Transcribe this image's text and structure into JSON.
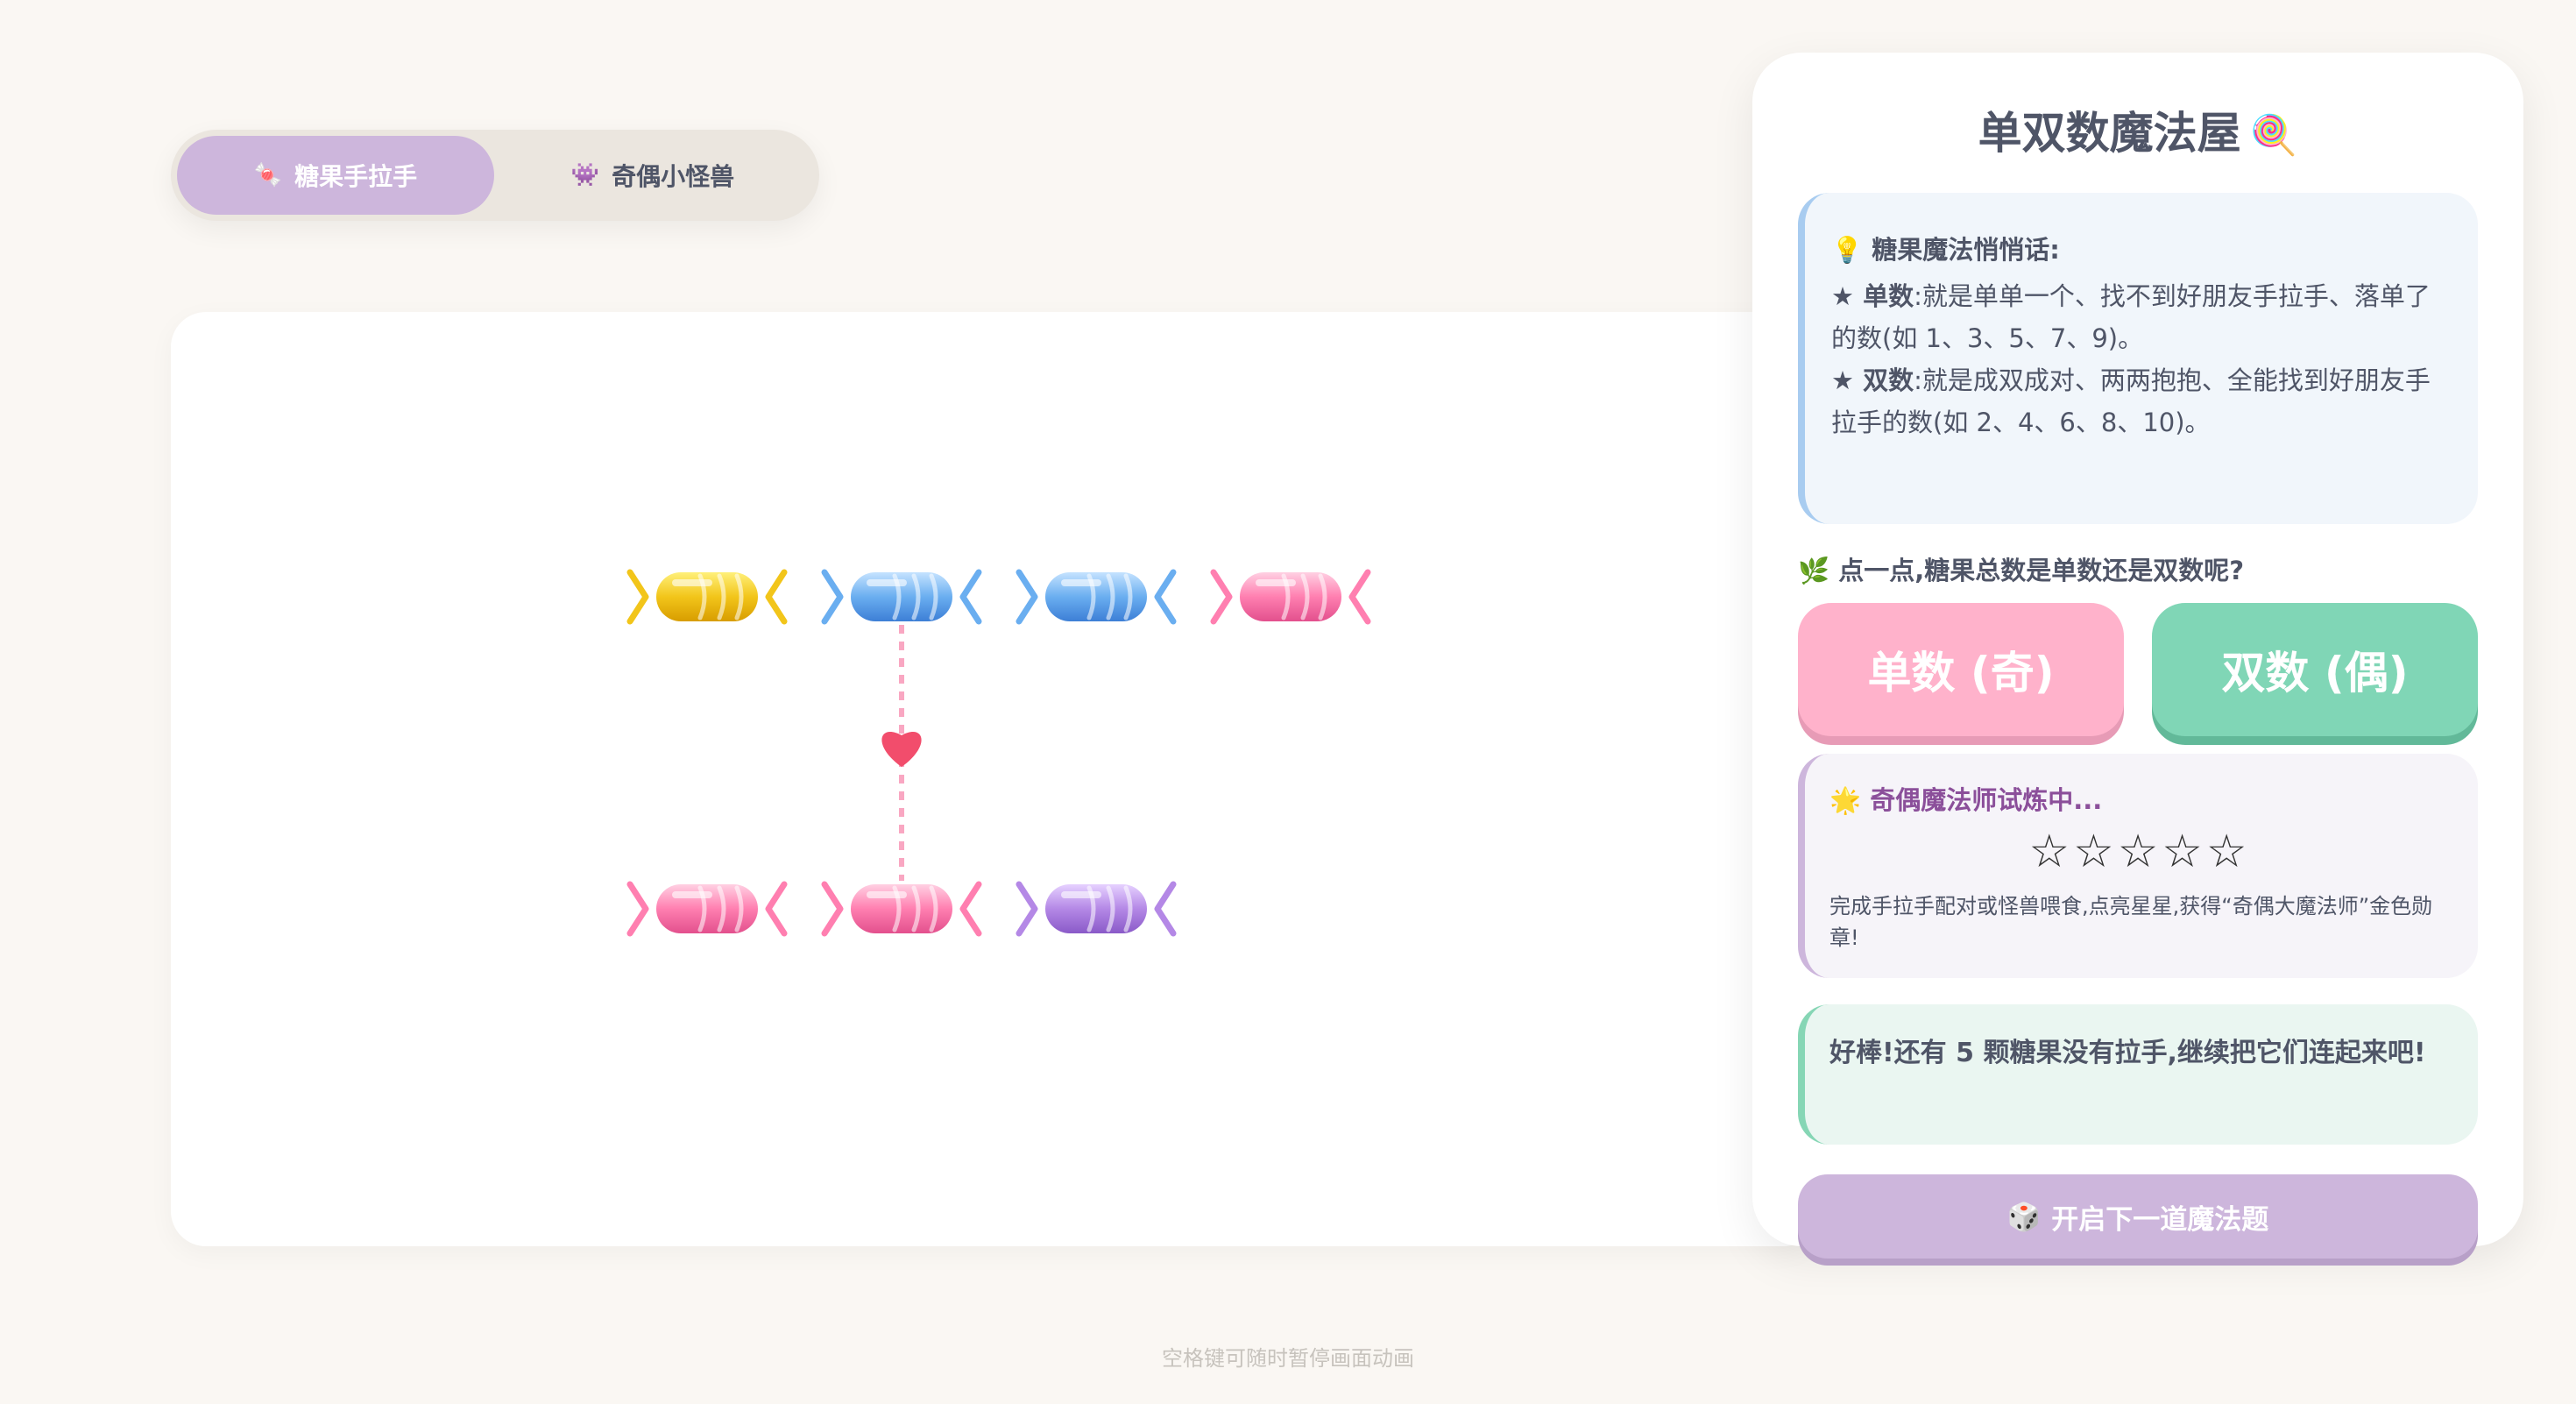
{
  "tabs": [
    {
      "icon": "🍬",
      "icon_name": "candy-icon",
      "label": "糖果手拉手",
      "active": true
    },
    {
      "icon": "👾",
      "icon_name": "monster-icon",
      "label": "奇偶小怪兽",
      "active": false
    }
  ],
  "stage": {
    "rows": [
      [
        "yellow",
        "blue",
        "blue",
        "pink"
      ],
      [
        "pink",
        "pink",
        "purple"
      ]
    ],
    "pairs": [
      {
        "top_index": 1,
        "bottom_index": 1
      }
    ],
    "candy_colors": {
      "yellow": [
        "#fff07a",
        "#f2c51a",
        "#d89d00"
      ],
      "blue": [
        "#c5e3ff",
        "#6aaef0",
        "#3d7fd6"
      ],
      "pink": [
        "#ffd0e3",
        "#ff7fb0",
        "#e3508d"
      ],
      "purple": [
        "#e6d1ff",
        "#b488e6",
        "#8a5ac8"
      ]
    },
    "link_color": "#f9a7c2",
    "heart_color": "#f24d6c"
  },
  "panel": {
    "title": "单双数魔法屋",
    "title_icon": "🍭",
    "tips": {
      "icon": "💡",
      "heading": "糖果魔法悄悄话:",
      "odd_label": "★ 单数",
      "odd_text": ":就是单单一个、找不到好朋友手拉手、落单了的数(如 1、3、5、7、9)。",
      "even_label": "★ 双数",
      "even_text": ":就是成双成对、两两抱抱、全能找到好朋友手拉手的数(如 2、4、6、8、10)。"
    },
    "question_icon": "🌿",
    "question": "点一点,糖果总数是单数还是双数呢?",
    "odd_button": "单数 (奇)",
    "even_button": "双数 (偶)",
    "trial": {
      "icon": "🌟",
      "heading": "奇偶魔法师试炼中...",
      "stars": "☆☆☆☆☆",
      "stars_filled": 0,
      "stars_total": 5,
      "description": "完成手拉手配对或怪兽喂食,点亮星星,获得“奇偶大魔法师”金色勋章!"
    },
    "feedback": "好棒!还有 5 颗糖果没有拉手,继续把它们连起来吧!",
    "next_icon": "🎲",
    "next_button": "开启下一道魔法题"
  },
  "hint": "空格键可随时暂停画面动画"
}
